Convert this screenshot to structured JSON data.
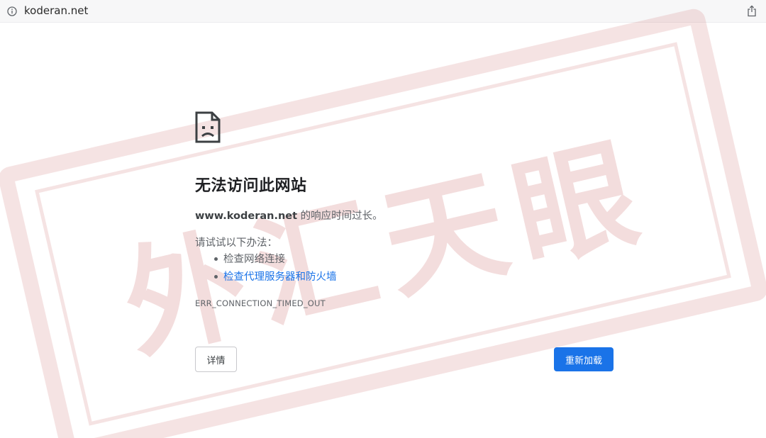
{
  "address_bar": {
    "url": "koderan.net",
    "info_icon": "info-circle-icon",
    "share_icon": "share-icon"
  },
  "watermark": {
    "text": "外汇天眼",
    "color": "#c85a5a"
  },
  "error": {
    "icon": "sad-document-icon",
    "title": "无法访问此网站",
    "host": "www.koderan.net",
    "description_suffix": " 的响应时间过长。",
    "suggestions_heading": "请试试以下办法：",
    "suggestions": [
      {
        "label": "检查网络连接",
        "is_link": false
      },
      {
        "label": "检查代理服务器和防火墙",
        "is_link": true
      }
    ],
    "code": "ERR_CONNECTION_TIMED_OUT"
  },
  "buttons": {
    "details_label": "详情",
    "reload_label": "重新加载"
  },
  "colors": {
    "accent": "#1a73e8",
    "text_primary": "#202124",
    "text_secondary": "#5f6368"
  }
}
